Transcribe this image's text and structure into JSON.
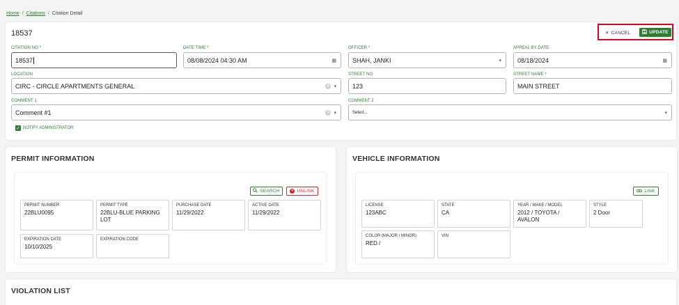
{
  "breadcrumb": {
    "home": "Home",
    "citations": "Citations",
    "current": "Citation Detail",
    "separator": "/"
  },
  "header": {
    "citation_id": "18537",
    "cancel_label": "CANCEL",
    "update_label": "UPDATE"
  },
  "form": {
    "citation_no": {
      "label": "CITATION NO *",
      "value": "18537"
    },
    "date_time": {
      "label": "DATE TIME *",
      "value": "08/08/2024 04:30 AM"
    },
    "officer": {
      "label": "OFFICER *",
      "value": "SHAH, JANKI"
    },
    "appeal_by_date": {
      "label": "APPEAL BY DATE",
      "value": "08/18/2024"
    },
    "location": {
      "label": "LOCATION",
      "value": "CIRC - CIRCLE APARTMENTS GENERAL"
    },
    "street_no": {
      "label": "STREET NO",
      "value": "123"
    },
    "street_name": {
      "label": "STREET NAME *",
      "value": "MAIN STREET"
    },
    "comment1": {
      "label": "COMMENT 1",
      "value": "Comment #1"
    },
    "comment2": {
      "label": "COMMENT 2",
      "placeholder": "Select..."
    },
    "notify_admin": {
      "label": "NOTIFY ADMINISTRATOR",
      "checked": true
    }
  },
  "permit": {
    "title": "PERMIT INFORMATION",
    "search_label": "SEARCH",
    "unlink_label": "UNLINK",
    "fields": [
      {
        "label": "PERMIT NUMBER",
        "value": "22BLU0095"
      },
      {
        "label": "PERMIT TYPE",
        "value": "22BLU-BLUE PARKING LOT"
      },
      {
        "label": "PURCHASE DATE",
        "value": "11/29/2022"
      },
      {
        "label": "ACTIVE DATE",
        "value": "11/29/2022"
      },
      {
        "label": "EXPIRATION DATE",
        "value": "10/10/2025"
      },
      {
        "label": "EXPIRATION CODE",
        "value": ""
      }
    ]
  },
  "vehicle": {
    "title": "VEHICLE INFORMATION",
    "link_label": "LINK",
    "fields": [
      {
        "label": "LICENSE",
        "value": "123ABC"
      },
      {
        "label": "STATE",
        "value": "CA"
      },
      {
        "label": "YEAR / MAKE / MODEL",
        "value": "2012 / TOYOTA / AVALON"
      },
      {
        "label": "STYLE",
        "value": "2 Door"
      },
      {
        "label": "COLOR (MAJOR / MINOR)",
        "value": "RED /"
      },
      {
        "label": "VIN",
        "value": ""
      }
    ]
  },
  "violation": {
    "title": "VIOLATION LIST"
  },
  "colors": {
    "accent": "#2e7d32",
    "danger": "#c62828",
    "highlight": "#e0001b"
  }
}
